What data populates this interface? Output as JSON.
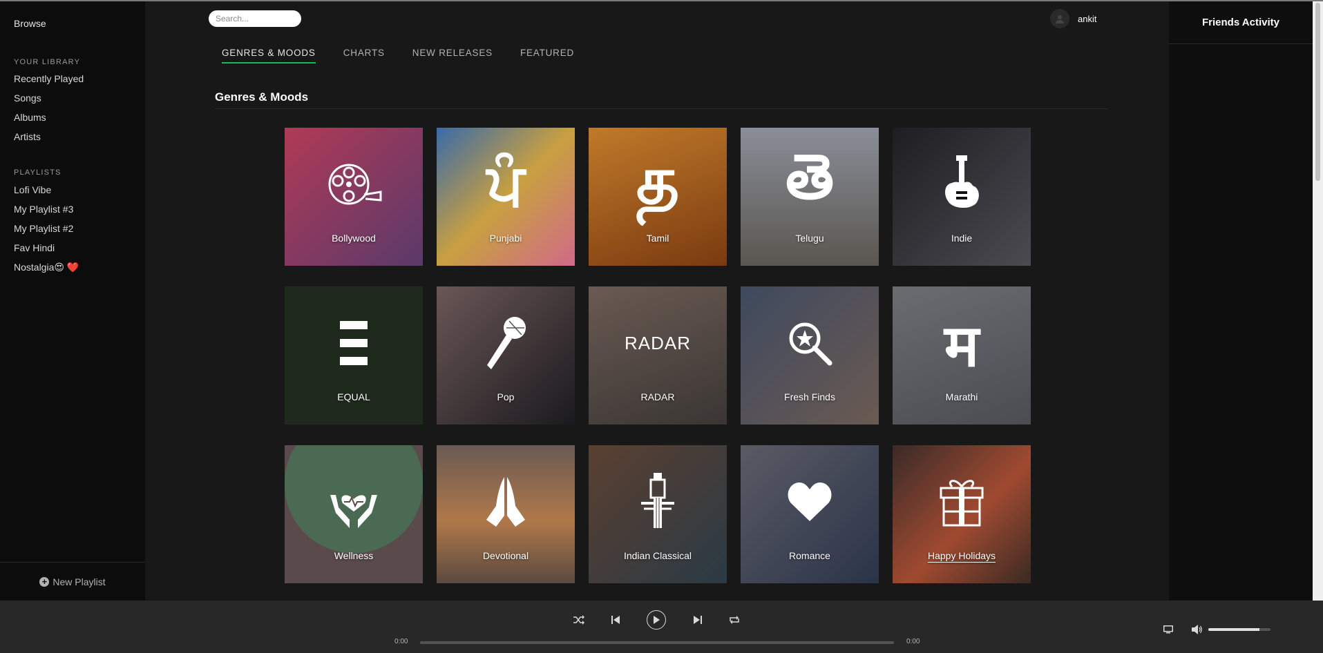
{
  "sidebar": {
    "browse": "Browse",
    "library_title": "YOUR LIBRARY",
    "library_items": [
      {
        "label": "Recently Played"
      },
      {
        "label": "Songs"
      },
      {
        "label": "Albums"
      },
      {
        "label": "Artists"
      }
    ],
    "playlists_title": "PLAYLISTS",
    "playlist_items": [
      {
        "label": "Lofi Vibe"
      },
      {
        "label": "My Playlist #3"
      },
      {
        "label": "My Playlist #2"
      },
      {
        "label": "Fav Hindi"
      },
      {
        "label": "Nostalgia😍 ❤️"
      }
    ],
    "new_playlist": "New Playlist"
  },
  "header": {
    "search_placeholder": "Search...",
    "username": "ankit"
  },
  "tabs": [
    {
      "label": "GENRES & MOODS",
      "active": true
    },
    {
      "label": "CHARTS"
    },
    {
      "label": "NEW RELEASES"
    },
    {
      "label": "FEATURED"
    }
  ],
  "section_title": "Genres & Moods",
  "tiles": [
    {
      "label": "Bollywood",
      "icon": "film-reel-icon",
      "bg": "#8a3a62"
    },
    {
      "label": "Punjabi",
      "icon": "gurmukhi-letter",
      "glyph": "ਪੰ",
      "bg": "#b08e3a"
    },
    {
      "label": "Tamil",
      "icon": "tamil-letter",
      "glyph": "த",
      "bg": "#9a5a20"
    },
    {
      "label": "Telugu",
      "icon": "telugu-letter",
      "glyph": "తె",
      "bg": "#7a7c82"
    },
    {
      "label": "Indie",
      "icon": "electric-guitar-icon",
      "bg": "#2c2c2e"
    },
    {
      "label": "EQUAL",
      "icon": "equal-bars-icon",
      "bg": "#1e2a1c"
    },
    {
      "label": "Pop",
      "icon": "microphone-icon",
      "bg": "#4a3a3a"
    },
    {
      "label": "RADAR",
      "icon": "radar-wordmark",
      "glyph": "RADAR",
      "bg": "#5e544e"
    },
    {
      "label": "Fresh Finds",
      "icon": "star-magnifier-icon",
      "bg": "#4a5060"
    },
    {
      "label": "Marathi",
      "icon": "devanagari-letter",
      "glyph": "म",
      "bg": "#5c5e62"
    },
    {
      "label": "Wellness",
      "icon": "heart-hands-icon",
      "bg": "#5a4a4c"
    },
    {
      "label": "Devotional",
      "icon": "praying-hands-icon",
      "bg": "#6a5240"
    },
    {
      "label": "Indian Classical",
      "icon": "sitar-icon",
      "bg": "#4a3830"
    },
    {
      "label": "Romance",
      "icon": "heart-icon",
      "bg": "#3c4458"
    },
    {
      "label": "Happy Holidays",
      "icon": "gift-icon",
      "bg": "#5a2a24"
    }
  ],
  "friends": {
    "title": "Friends Activity"
  },
  "player": {
    "current_time": "0:00",
    "total_time": "0:00",
    "progress": 0,
    "volume": 0.82
  }
}
